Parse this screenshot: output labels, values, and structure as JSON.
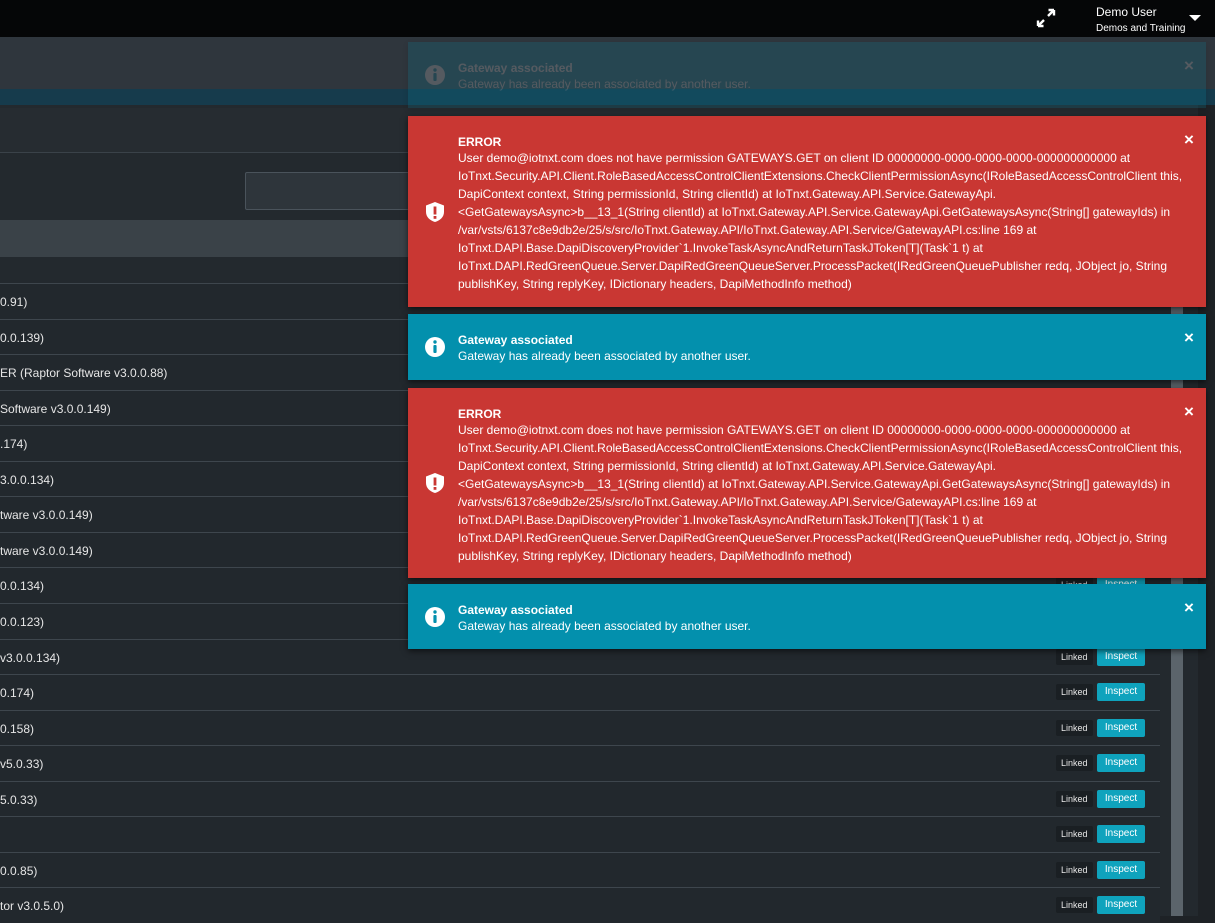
{
  "header": {
    "user_name": "Demo User",
    "user_org": "Demos and Training",
    "expand_icon": "expand-arrows-icon",
    "menu_icon": "caret-down-icon"
  },
  "rows": [
    {
      "name": "0.91)",
      "linked": "",
      "inspect": ""
    },
    {
      "name": "0.0.139)",
      "linked": "",
      "inspect": ""
    },
    {
      "name": "ER (Raptor Software v3.0.0.88)",
      "linked": "",
      "inspect": ""
    },
    {
      "name": "Software v3.0.0.149)",
      "linked": "",
      "inspect": ""
    },
    {
      "name": ".174)",
      "linked": "",
      "inspect": ""
    },
    {
      "name": "3.0.0.134)",
      "linked": "",
      "inspect": ""
    },
    {
      "name": "tware v3.0.0.149)",
      "linked": "",
      "inspect": ""
    },
    {
      "name": "tware v3.0.0.149)",
      "linked": "",
      "inspect": ""
    },
    {
      "name": "0.0.134)",
      "linked": "Linked",
      "inspect": "Inspect"
    },
    {
      "name": "0.0.123)",
      "linked": "",
      "inspect": ""
    },
    {
      "name": "v3.0.0.134)",
      "linked": "Linked",
      "inspect": "Inspect"
    },
    {
      "name": "0.174)",
      "linked": "Linked",
      "inspect": "Inspect"
    },
    {
      "name": "0.158)",
      "linked": "Linked",
      "inspect": "Inspect"
    },
    {
      "name": "v5.0.33)",
      "linked": "Linked",
      "inspect": "Inspect"
    },
    {
      "name": "5.0.33)",
      "linked": "Linked",
      "inspect": "Inspect"
    },
    {
      "name": "",
      "linked": "Linked",
      "inspect": "Inspect"
    },
    {
      "name": "0.0.85)",
      "linked": "Linked",
      "inspect": "Inspect"
    },
    {
      "name": "tor v3.0.5.0)",
      "linked": "Linked",
      "inspect": "Inspect"
    }
  ],
  "toasts": [
    {
      "type": "info",
      "title": "Gateway associated",
      "message": "Gateway has already been associated by another user.",
      "close": "×"
    },
    {
      "type": "error",
      "title": "ERROR",
      "message": "User demo@iotnxt.com does not have permission GATEWAYS.GET on client ID 00000000-0000-0000-0000-000000000000 at IoTnxt.Security.API.Client.RoleBasedAccessControlClientExtensions.CheckClientPermissionAsync(IRoleBasedAccessControlClient this, DapiContext context, String permissionId, String clientId) at IoTnxt.Gateway.API.Service.GatewayApi.<GetGatewaysAsync>b__13_1(String clientId) at IoTnxt.Gateway.API.Service.GatewayApi.GetGatewaysAsync(String[] gatewayIds) in /var/vsts/6137c8e9db2e/25/s/src/IoTnxt.Gateway.API/IoTnxt.Gateway.API.Service/GatewayAPI.cs:line 169 at IoTnxt.DAPI.Base.DapiDiscoveryProvider`1.InvokeTaskAsyncAndReturnTaskJToken[T](Task`1 t) at IoTnxt.DAPI.RedGreenQueue.Server.DapiRedGreenQueueServer.ProcessPacket(IRedGreenQueuePublisher redq, JObject jo, String publishKey, String replyKey, IDictionary headers, DapiMethodInfo method)",
      "close": "×"
    },
    {
      "type": "info",
      "title": "Gateway associated",
      "message": "Gateway has already been associated by another user.",
      "close": "×"
    },
    {
      "type": "error",
      "title": "ERROR",
      "message": "User demo@iotnxt.com does not have permission GATEWAYS.GET on client ID 00000000-0000-0000-0000-000000000000 at IoTnxt.Security.API.Client.RoleBasedAccessControlClientExtensions.CheckClientPermissionAsync(IRoleBasedAccessControlClient this, DapiContext context, String permissionId, String clientId) at IoTnxt.Gateway.API.Service.GatewayApi.<GetGatewaysAsync>b__13_1(String clientId) at IoTnxt.Gateway.API.Service.GatewayApi.GetGatewaysAsync(String[] gatewayIds) in /var/vsts/6137c8e9db2e/25/s/src/IoTnxt.Gateway.API/IoTnxt.Gateway.API.Service/GatewayAPI.cs:line 169 at IoTnxt.DAPI.Base.DapiDiscoveryProvider`1.InvokeTaskAsyncAndReturnTaskJToken[T](Task`1 t) at IoTnxt.DAPI.RedGreenQueue.Server.DapiRedGreenQueueServer.ProcessPacket(IRedGreenQueuePublisher redq, JObject jo, String publishKey, String replyKey, IDictionary headers, DapiMethodInfo method)",
      "close": "×"
    },
    {
      "type": "info",
      "title": "Gateway associated",
      "message": "Gateway has already been associated by another user.",
      "close": "×"
    }
  ],
  "colors": {
    "info": "#0390ad",
    "error": "#c93733",
    "inspect": "#0fa3bd"
  }
}
